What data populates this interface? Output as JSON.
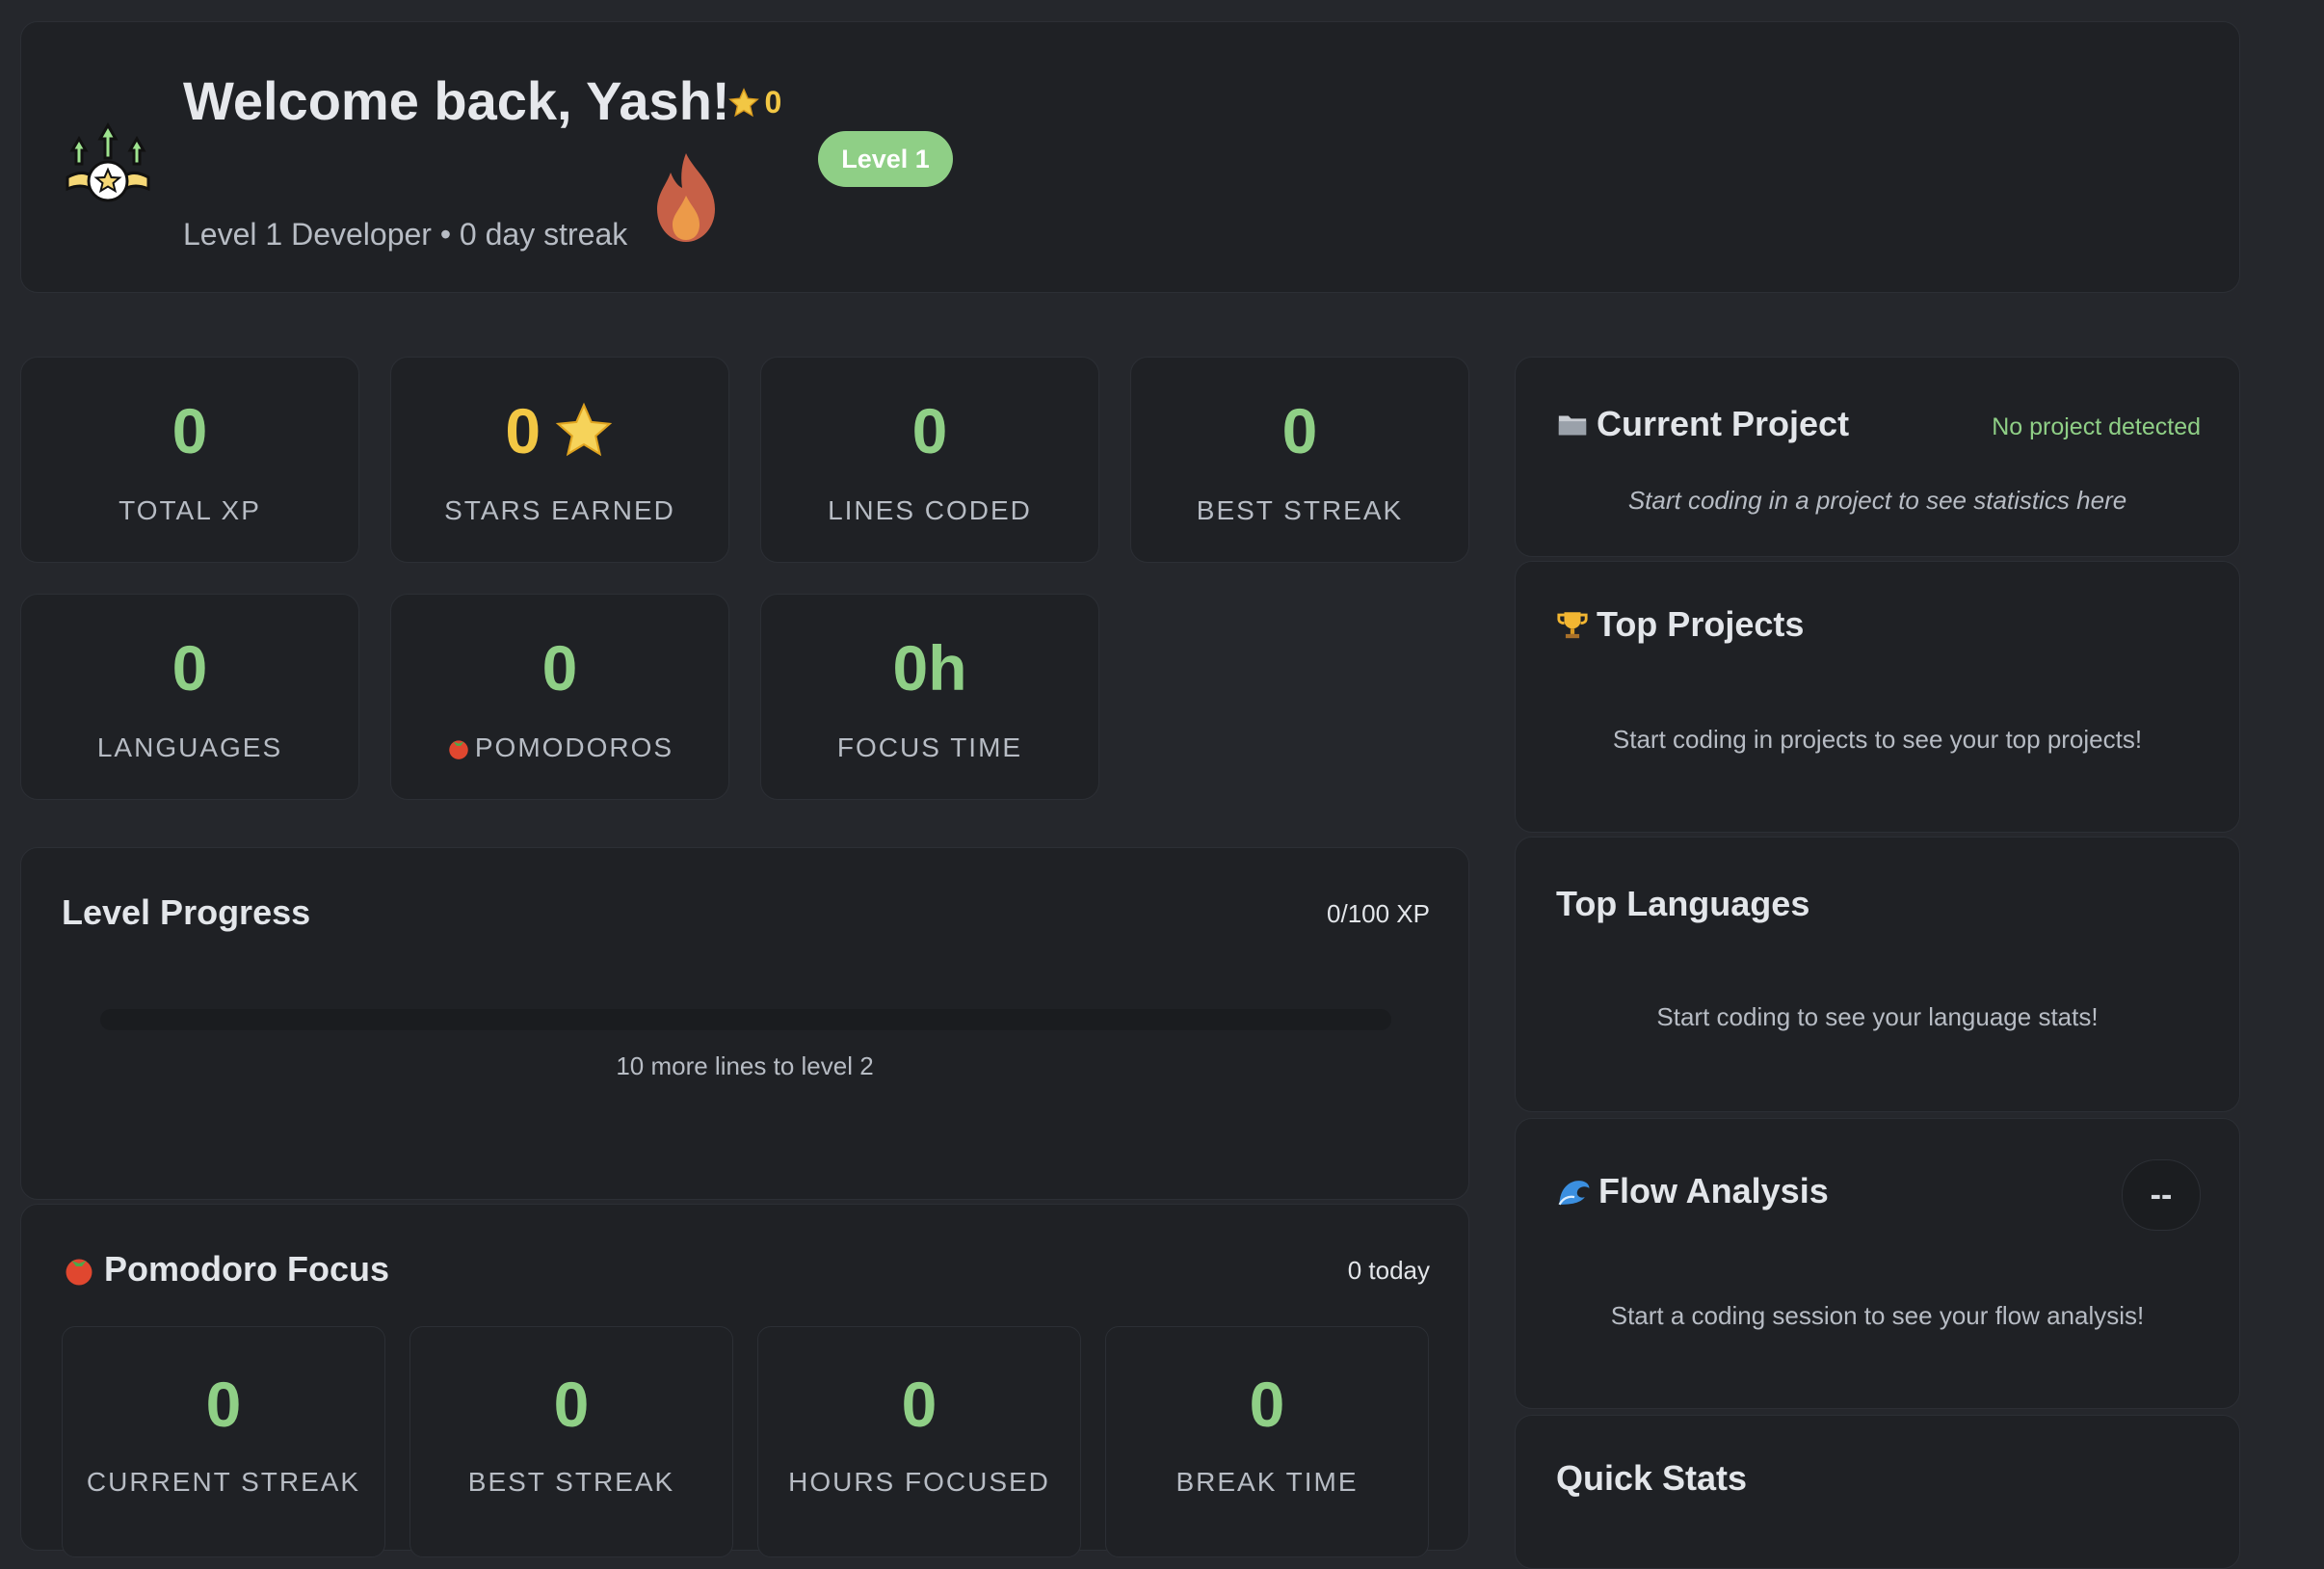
{
  "header": {
    "welcome": "Welcome back, Yash!",
    "star_count": "0",
    "subtitle": "Level 1 Developer • 0 day streak",
    "level_badge": "Level 1",
    "logo_icon": "trophy-arrows-star-icon",
    "fire_icon": "fire-icon"
  },
  "stats": [
    {
      "value": "0",
      "label": "TOTAL XP"
    },
    {
      "value": "0",
      "label": "STARS EARNED",
      "icon": "star-icon"
    },
    {
      "value": "0",
      "label": "LINES CODED"
    },
    {
      "value": "0",
      "label": "BEST STREAK"
    },
    {
      "value": "0",
      "label": "LANGUAGES"
    },
    {
      "value": "0",
      "label": "POMODOROS",
      "icon": "tomato-icon"
    },
    {
      "value": "0h",
      "label": "FOCUS TIME"
    }
  ],
  "level_progress": {
    "title": "Level Progress",
    "xp": "0/100 XP",
    "progress_fraction": 0,
    "note": "10 more lines to level 2"
  },
  "pomodoro": {
    "title": "Pomodoro Focus",
    "today": "0 today",
    "icon": "tomato-icon",
    "stats": [
      {
        "value": "0",
        "label": "CURRENT STREAK"
      },
      {
        "value": "0",
        "label": "BEST STREAK"
      },
      {
        "value": "0",
        "label": "HOURS FOCUSED"
      },
      {
        "value": "0",
        "label": "BREAK TIME"
      }
    ]
  },
  "current_project": {
    "title": "Current Project",
    "icon": "folder-icon",
    "status": "No project detected",
    "message": "Start coding in a project to see statistics here"
  },
  "top_projects": {
    "title": "Top Projects",
    "icon": "trophy-icon",
    "message": "Start coding in projects to see your top projects!"
  },
  "top_languages": {
    "title": "Top Languages",
    "message": "Start coding to see your language stats!"
  },
  "flow_analysis": {
    "title": "Flow Analysis",
    "icon": "wave-icon",
    "badge": "--",
    "message": "Start a coding session to see your flow analysis!"
  },
  "quick_stats": {
    "title": "Quick Stats"
  },
  "colors": {
    "background": "#25272c",
    "card": "#1f2125",
    "accent_green": "#8fcf86",
    "star_yellow": "#f2c744"
  }
}
